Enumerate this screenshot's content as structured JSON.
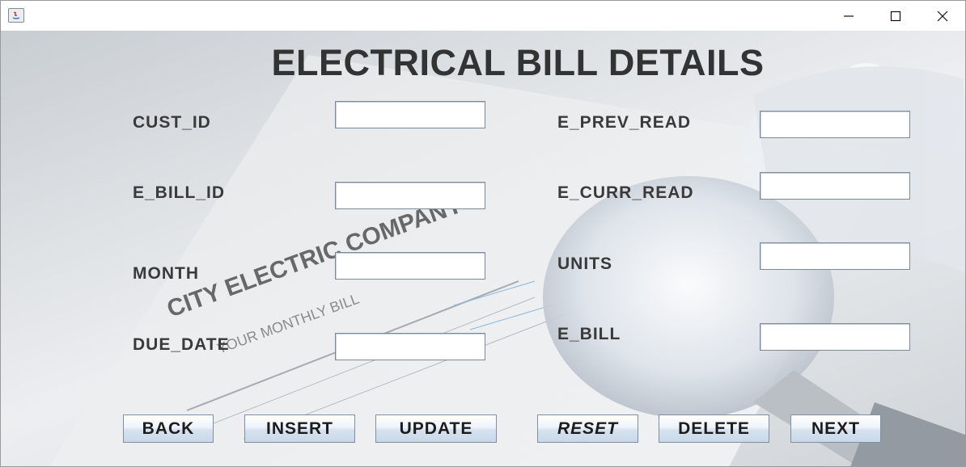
{
  "window": {
    "title": "",
    "controls": {
      "minimize": "minimize-icon",
      "maximize": "maximize-icon",
      "close": "close-icon"
    }
  },
  "page": {
    "title": "ELECTRICAL BILL DETAILS"
  },
  "form": {
    "left_fields": [
      {
        "label": "CUST_ID",
        "value": ""
      },
      {
        "label": "E_BILL_ID",
        "value": ""
      },
      {
        "label": "MONTH",
        "value": ""
      },
      {
        "label": "DUE_DATE",
        "value": ""
      }
    ],
    "right_fields": [
      {
        "label": "E_PREV_READ",
        "value": ""
      },
      {
        "label": "E_CURR_READ",
        "value": ""
      },
      {
        "label": "UNITS",
        "value": ""
      },
      {
        "label": "E_BILL",
        "value": ""
      }
    ]
  },
  "buttons": {
    "back": "BACK",
    "insert": "INSERT",
    "update": "UPDATE",
    "reset": "RESET",
    "delete": "DELETE",
    "next": "NEXT"
  },
  "background": {
    "company": "CITY ELECTRIC COMPANY",
    "bill_heading": "YOUR MONTHLY BILL"
  }
}
